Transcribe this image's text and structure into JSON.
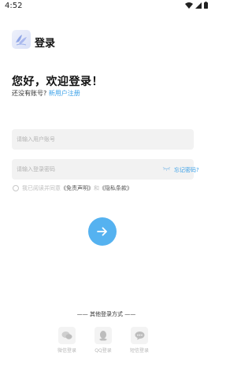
{
  "status_bar": {
    "time": "4:52"
  },
  "header": {
    "title": "登录",
    "logo_icon": "app-logo-icon"
  },
  "welcome": {
    "title": "您好，欢迎登录！",
    "no_account_text": "还没有账号?",
    "register_link": "新用户注册"
  },
  "form": {
    "username_placeholder": "请输入用户账号",
    "password_placeholder": "请输入登录密码",
    "forgot_password": "忘记密码?"
  },
  "agreement": {
    "prefix": "我已阅读并同意",
    "disclaimer_link": "《免责声明》",
    "conjunction": "和",
    "privacy_link": "《隐私条款》",
    "checked": false
  },
  "submit": {
    "icon": "arrow-right-icon"
  },
  "other_login": {
    "title": "—— 其他登录方式 ——",
    "items": [
      {
        "label": "微信登录",
        "icon": "wechat-icon"
      },
      {
        "label": "QQ登录",
        "icon": "qq-icon"
      },
      {
        "label": "短信登录",
        "icon": "sms-icon"
      }
    ]
  },
  "colors": {
    "accent": "#3aa0e8",
    "submit_button": "#55b2f0",
    "field_background": "#f2f2f2"
  }
}
